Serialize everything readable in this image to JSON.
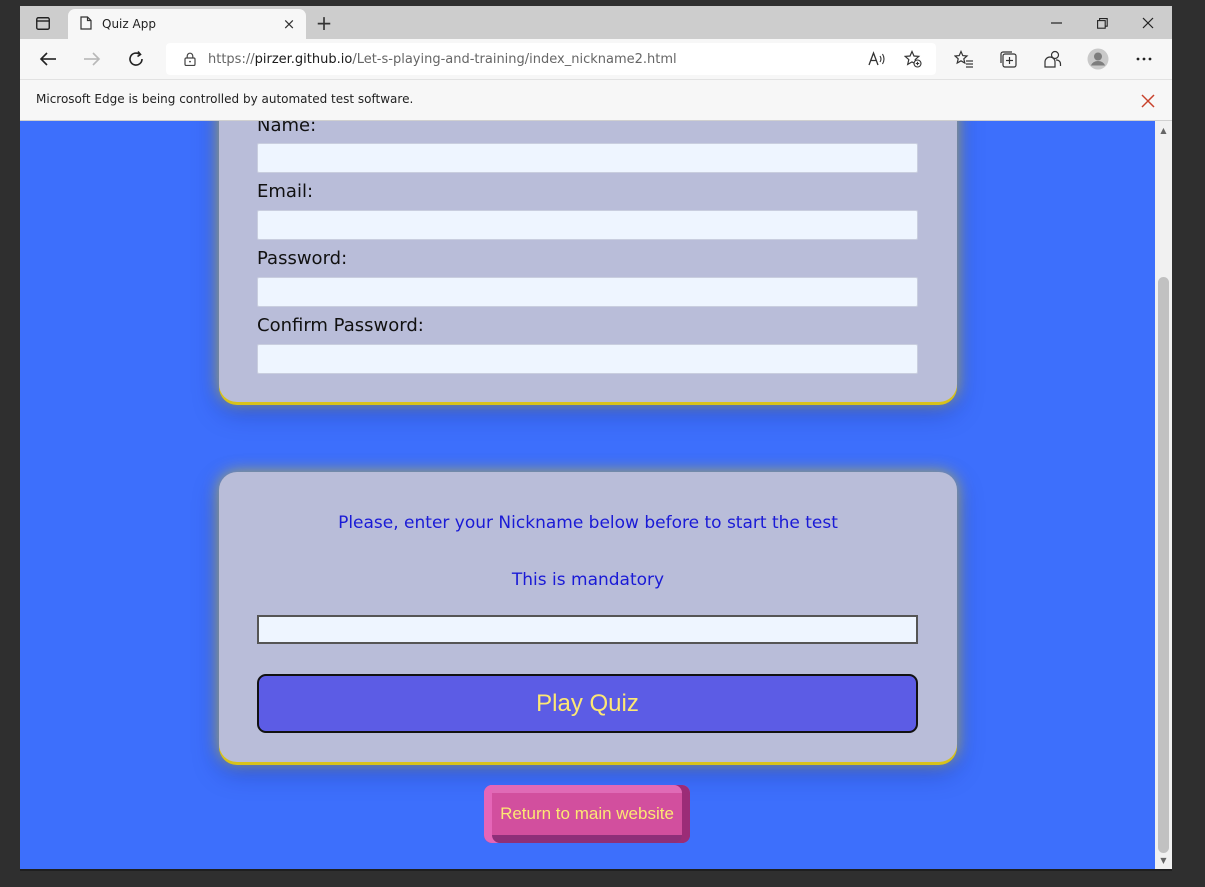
{
  "browser": {
    "tab_title": "Quiz App",
    "tab_close": "×",
    "new_tab": "+",
    "url_scheme": "https://",
    "url_host": "pirzer.github.io",
    "url_path": "/Let-s-playing-and-training/index_nickname2.html",
    "infobar_text": "Microsoft Edge is being controlled by automated test software."
  },
  "registration_form": {
    "name_label": "Name:",
    "name_value": "",
    "email_label": "Email:",
    "email_value": "",
    "password_label": "Password:",
    "password_value": "",
    "confirm_password_label": "Confirm Password:",
    "confirm_password_value": ""
  },
  "nickname_card": {
    "prompt": "Please, enter your Nickname below before to start the test",
    "mandatory_note": "This is mandatory",
    "nickname_value": "",
    "play_button_label": "Play Quiz"
  },
  "return_button_label": "Return to main website",
  "colors": {
    "page_background": "#3d6ffc",
    "card_background": "#b9bdd9",
    "card_glow": "#d8c21a",
    "prompt_text": "#1a1ad6",
    "play_button": "#5c5ce5",
    "button_text": "#fde873",
    "return_button": "#d24f9e"
  }
}
